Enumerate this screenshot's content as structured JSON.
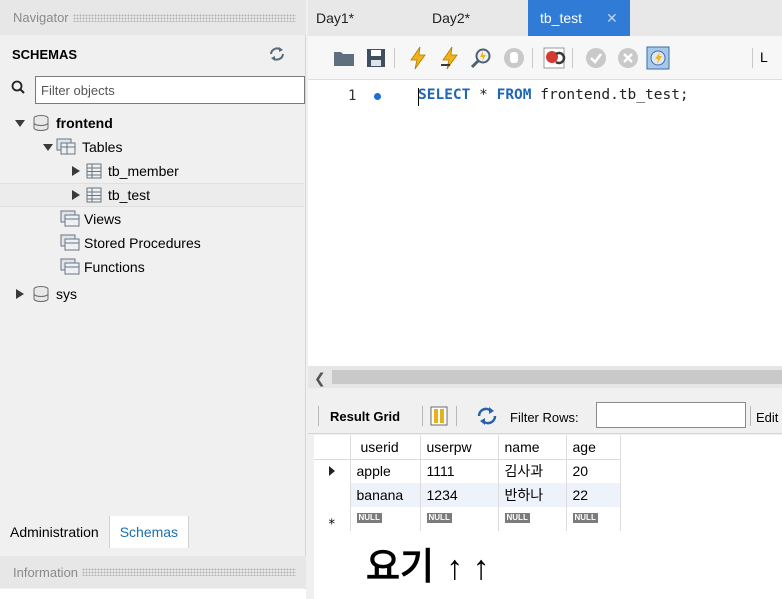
{
  "navigator": {
    "header": "Navigator",
    "schemas_title": "SCHEMAS",
    "filter_placeholder": "Filter objects",
    "tree": [
      {
        "label": "frontend"
      },
      {
        "label": "Tables"
      },
      {
        "label": "tb_member"
      },
      {
        "label": "tb_test"
      },
      {
        "label": "Views"
      },
      {
        "label": "Stored Procedures"
      },
      {
        "label": "Functions"
      },
      {
        "label": "sys"
      }
    ],
    "bottom_tabs": [
      "Administration",
      "Schemas"
    ],
    "info_header": "Information"
  },
  "editor_tabs": [
    "Day1*",
    "Day2*",
    "tb_test"
  ],
  "toolbar": {
    "limit_text": "L",
    "icons": [
      "open-folder-icon",
      "save-icon",
      "execute-lightning-icon",
      "execute-cursor-icon",
      "explain-magnifier-icon",
      "stop-icon",
      "toggle-error-icon",
      "commit-icon",
      "rollback-icon",
      "autocommit-icon"
    ]
  },
  "query": {
    "line_number": "1",
    "keyword_select": "SELECT",
    "middle": " * ",
    "keyword_from": "FROM",
    "rest": " frontend.tb_test;"
  },
  "result": {
    "result_grid_label": "Result Grid",
    "filter_rows_label": "Filter Rows:",
    "edit_label": "Edit",
    "columns": [
      "userid",
      "userpw",
      "name",
      "age"
    ],
    "rows": [
      [
        "apple",
        "1111",
        "김사과",
        "20"
      ],
      [
        "banana",
        "1234",
        "반하나",
        "22"
      ]
    ],
    "null_label": "NULL"
  },
  "annotation": {
    "text": "요기",
    "arrows": "↑ ↑"
  },
  "colors": {
    "active_tab": "#2f7bd6",
    "keyword": "#1f66b5",
    "link_tab": "#1a6fb3"
  }
}
